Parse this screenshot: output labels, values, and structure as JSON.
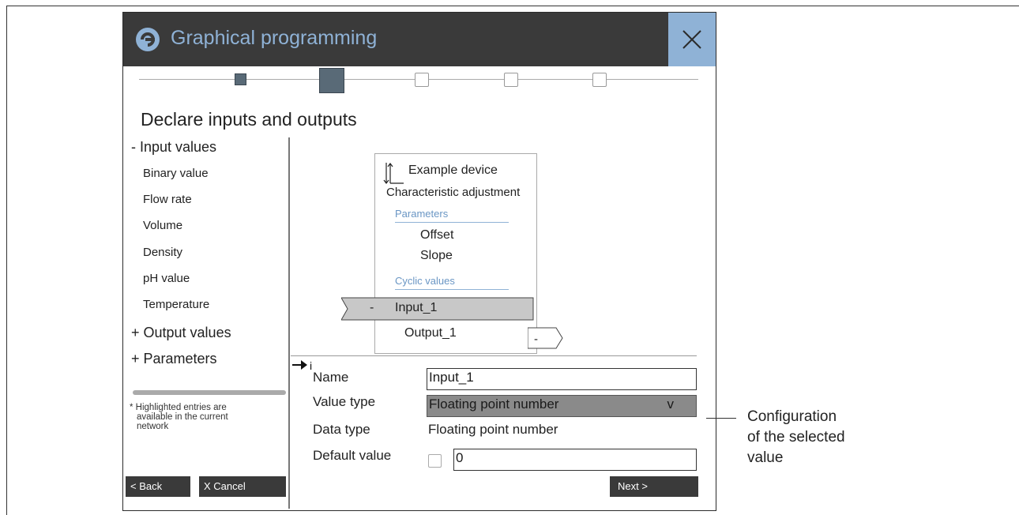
{
  "window": {
    "title": "Graphical programming",
    "page_heading": "Declare inputs and outputs",
    "close_icon": "close-icon"
  },
  "stepper": {
    "steps": [
      "done",
      "current",
      "todo",
      "todo",
      "todo"
    ]
  },
  "sidebar": {
    "input_group": "- Input values",
    "input_items": [
      "Binary value",
      "Flow rate",
      "Volume",
      "Density",
      "pH value",
      "Temperature"
    ],
    "output_group": "+ Output values",
    "parameters_group": "+ Parameters",
    "note_line1": "* Highlighted entries are",
    "note_line2": "available in the current",
    "note_line3": "network"
  },
  "buttons": {
    "back": "< Back",
    "cancel": "X Cancel",
    "next": "Next  >"
  },
  "device": {
    "name": "Example device",
    "function": "Characteristic adjustment",
    "parameters_label": "Parameters",
    "parameters": [
      "Offset",
      "Slope"
    ],
    "cyclic_label": "Cyclic values",
    "input_dash": "-",
    "input": "Input_1",
    "output": "Output_1",
    "output_dash": "-"
  },
  "form": {
    "info_marker": "i",
    "name_label": "Name",
    "name_value": "Input_1",
    "value_type_label": "Value type",
    "value_type_value": "Floating point number",
    "value_type_arrow": "v",
    "data_type_label": "Data type",
    "data_type_value": "Floating point number",
    "default_label": "Default value",
    "default_value": "0"
  },
  "callout": {
    "line1": "Configuration",
    "line2": "of the selected",
    "line3": "value"
  },
  "colors": {
    "titlebar": "#3a3a3a",
    "accent": "#8fb2d6",
    "step_fill": "#596a77",
    "highlight": "#c8c8c8",
    "select_fill": "#8a8a8a"
  }
}
